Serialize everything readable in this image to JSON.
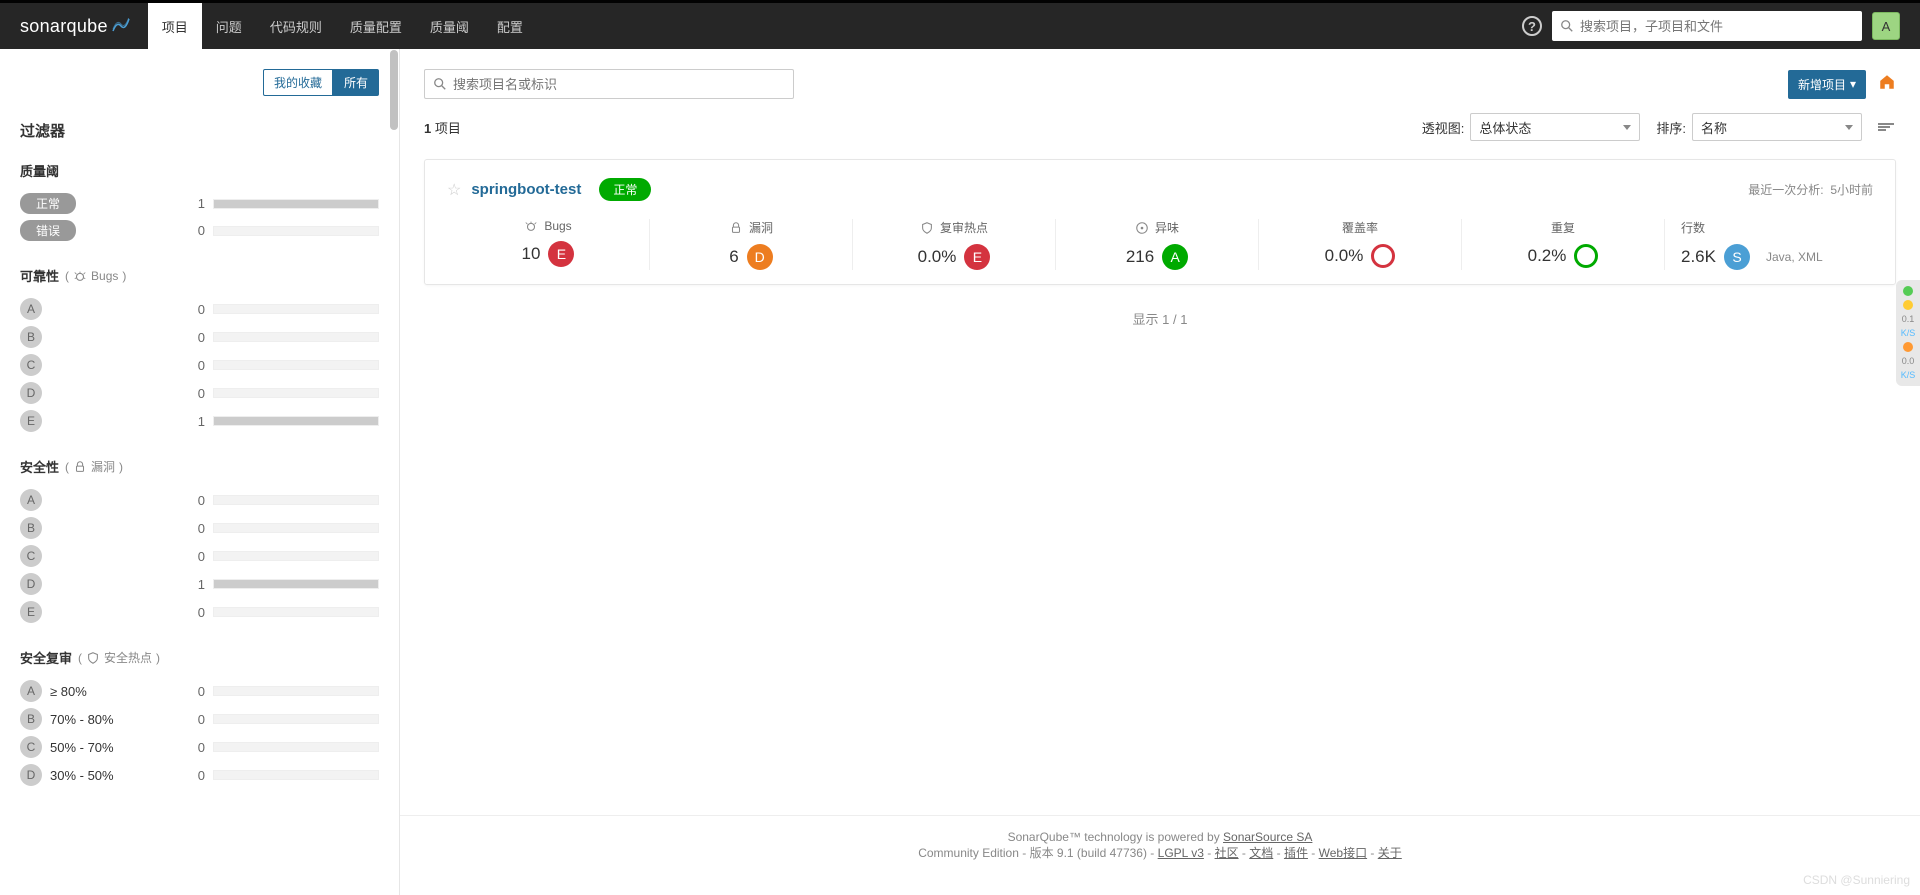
{
  "nav": {
    "logo": "sonarqube",
    "items": [
      "项目",
      "问题",
      "代码规则",
      "质量配置",
      "质量阈",
      "配置"
    ],
    "activeIndex": 0,
    "searchPlaceholder": "搜索项目，子项目和文件",
    "userInitial": "A"
  },
  "sidebar": {
    "favTab": "我的收藏",
    "allTab": "所有",
    "filtersTitle": "过滤器",
    "qualityGate": {
      "title": "质量阈",
      "ok": {
        "label": "正常",
        "count": 1,
        "barPct": 100
      },
      "error": {
        "label": "错误",
        "count": 0,
        "barPct": 0
      }
    },
    "reliability": {
      "title": "可靠性",
      "subLabel": "Bugs",
      "rows": [
        {
          "rating": "A",
          "count": 0,
          "barPct": 0
        },
        {
          "rating": "B",
          "count": 0,
          "barPct": 0
        },
        {
          "rating": "C",
          "count": 0,
          "barPct": 0
        },
        {
          "rating": "D",
          "count": 0,
          "barPct": 0
        },
        {
          "rating": "E",
          "count": 1,
          "barPct": 100
        }
      ]
    },
    "security": {
      "title": "安全性",
      "subLabel": "漏洞",
      "rows": [
        {
          "rating": "A",
          "count": 0,
          "barPct": 0
        },
        {
          "rating": "B",
          "count": 0,
          "barPct": 0
        },
        {
          "rating": "C",
          "count": 0,
          "barPct": 0
        },
        {
          "rating": "D",
          "count": 1,
          "barPct": 100
        },
        {
          "rating": "E",
          "count": 0,
          "barPct": 0
        }
      ]
    },
    "securityReview": {
      "title": "安全复审",
      "subLabel": "安全热点",
      "rows": [
        {
          "rating": "A",
          "label": "≥ 80%",
          "count": 0
        },
        {
          "rating": "B",
          "label": "70% - 80%",
          "count": 0
        },
        {
          "rating": "C",
          "label": "50% - 70%",
          "count": 0
        },
        {
          "rating": "D",
          "label": "30% - 50%",
          "count": 0
        }
      ]
    }
  },
  "main": {
    "projectSearchPlaceholder": "搜索项目名或标识",
    "newProjectBtn": "新增项目",
    "projectCount": "1",
    "projectCountLabel": "项目",
    "perspectiveLabel": "透视图:",
    "perspectiveValue": "总体状态",
    "sortLabel": "排序:",
    "sortValue": "名称"
  },
  "project": {
    "name": "springboot-test",
    "status": "正常",
    "lastAnalysisLabel": "最近一次分析:",
    "lastAnalysisValue": "5小时前",
    "metrics": {
      "bugs": {
        "label": "Bugs",
        "value": "10",
        "rating": "E"
      },
      "vulnerabilities": {
        "label": "漏洞",
        "value": "6",
        "rating": "D"
      },
      "hotspots": {
        "label": "复审热点",
        "value": "0.0%",
        "rating": "E"
      },
      "codeSmells": {
        "label": "异味",
        "value": "216",
        "rating": "A"
      },
      "coverage": {
        "label": "覆盖率",
        "value": "0.0%",
        "ring": "red"
      },
      "duplications": {
        "label": "重复",
        "value": "0.2%",
        "ring": "green"
      },
      "lines": {
        "label": "行数",
        "value": "2.6K",
        "langRating": "S",
        "langs": "Java, XML"
      }
    }
  },
  "showing": "显示 1 / 1",
  "footer": {
    "line1a": "SonarQube™ technology is powered by ",
    "line1b": "SonarSource SA",
    "line2": "Community Edition - 版本 9.1 (build 47736) - ",
    "links": [
      "LGPL v3",
      "社区",
      "文档",
      "插件",
      "Web接口",
      "关于"
    ]
  },
  "watermark": "CSDN @Sunniering",
  "sideWidget": {
    "v1": "0.1",
    "u1": "K/S",
    "v2": "0.0",
    "u2": "K/S"
  }
}
